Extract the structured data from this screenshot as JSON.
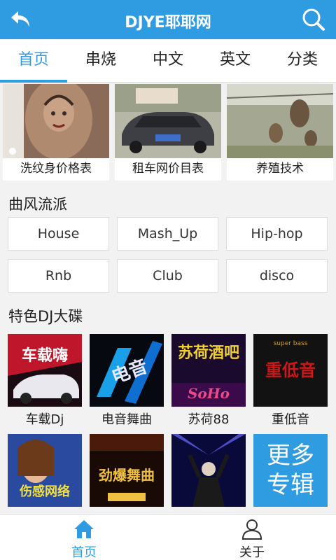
{
  "app_bar": {
    "title": "DJYE耶耶网"
  },
  "tabs": [
    {
      "label": "首页",
      "active": true
    },
    {
      "label": "串烧",
      "active": false
    },
    {
      "label": "中文",
      "active": false
    },
    {
      "label": "英文",
      "active": false
    },
    {
      "label": "分类",
      "active": false
    }
  ],
  "banners": [
    {
      "caption": "洗纹身价格表"
    },
    {
      "caption": "租车网价目表"
    },
    {
      "caption": "养殖技术"
    }
  ],
  "styles_section": {
    "title": "曲风流派",
    "items": [
      "House",
      "Mash_Up",
      "Hip-hop",
      "Rnb",
      "Club",
      "disco"
    ]
  },
  "featured_section": {
    "title": "特色DJ大碟",
    "albums": [
      {
        "caption": "车载Dj",
        "cover_text": "车载嗨"
      },
      {
        "caption": "电音舞曲",
        "cover_text": "电音"
      },
      {
        "caption": "苏荷88",
        "cover_text": "苏荷酒吧"
      },
      {
        "caption": "重低音",
        "cover_text": "重低音"
      },
      {
        "caption": "",
        "cover_text": "伤感网络"
      },
      {
        "caption": "",
        "cover_text": "劲爆舞曲"
      },
      {
        "caption": "",
        "cover_text": ""
      }
    ],
    "more_tile": {
      "line1": "更多",
      "line2": "专辑"
    }
  },
  "bottom_nav": [
    {
      "label": "首页",
      "active": true
    },
    {
      "label": "关于",
      "active": false
    }
  ],
  "colors": {
    "accent": "#2f9be0",
    "text": "#222222",
    "border": "#dcdcdc"
  }
}
